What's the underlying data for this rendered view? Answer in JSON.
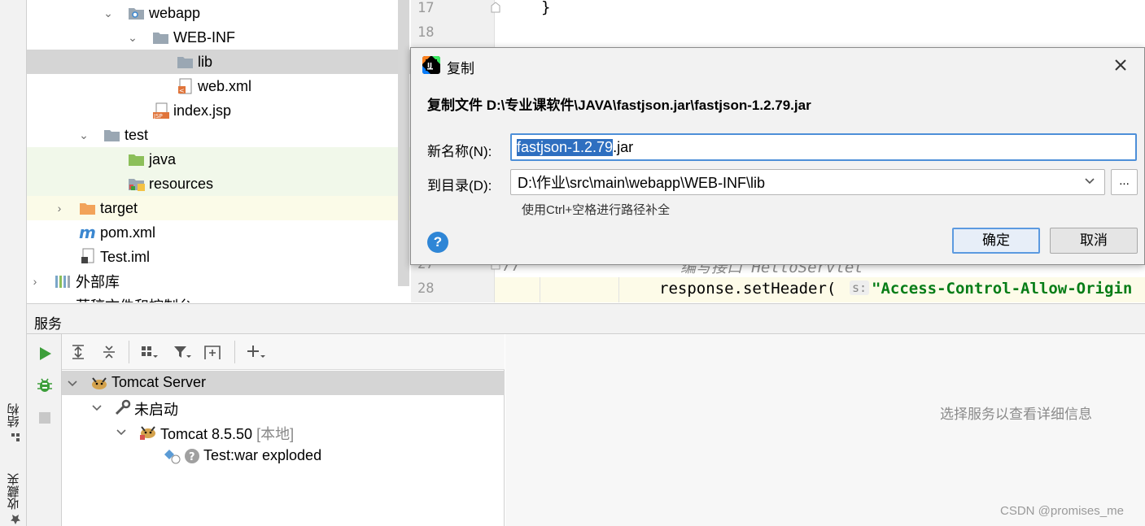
{
  "left_strip": {
    "structure_tab": "结构",
    "favorites_tab": "收藏夹"
  },
  "project_tree": {
    "items": [
      {
        "label": "webapp"
      },
      {
        "label": "WEB-INF"
      },
      {
        "label": "lib"
      },
      {
        "label": "web.xml"
      },
      {
        "label": "index.jsp"
      },
      {
        "label": "test"
      },
      {
        "label": "java"
      },
      {
        "label": "resources"
      },
      {
        "label": "target"
      },
      {
        "label": "pom.xml"
      },
      {
        "label": "Test.iml"
      },
      {
        "label": "外部库"
      },
      {
        "label": "草稿文件和控制台"
      }
    ]
  },
  "editor": {
    "line_numbers": [
      "17",
      "18",
      "27",
      "28"
    ],
    "line17_code": "}",
    "line27_code": "//",
    "line27_comment": "编写接口 HelloServlet",
    "line28_code": "response.setHeader(",
    "line28_hint": "s:",
    "line28_string": "\"Access-Control-Allow-Origin"
  },
  "dialog": {
    "title": "复制",
    "heading": "复制文件 D:\\专业课软件\\JAVA\\fastjson.jar\\fastjson-1.2.79.jar",
    "name_label": "新名称(N):",
    "name_value_selected": "fastjson-1.2.79",
    "name_value_rest": ".jar",
    "dir_label": "到目录(D):",
    "dir_value": "D:\\作业\\src\\main\\webapp\\WEB-INF\\lib",
    "browse_label": "...",
    "hint": "使用Ctrl+空格进行路径补全",
    "help_label": "?",
    "ok_label": "确定",
    "cancel_label": "取消"
  },
  "services": {
    "title": "服务",
    "tree": [
      {
        "label": "Tomcat Server"
      },
      {
        "label": "未启动"
      },
      {
        "label": "Tomcat 8.5.50",
        "suffix": "[本地]"
      },
      {
        "label": "Test:war exploded"
      }
    ],
    "detail_placeholder": "选择服务以查看详细信息"
  },
  "watermark": "CSDN @promises_me",
  "colors": {
    "accent": "#4d8fd8",
    "selection": "#2e6fc0",
    "run_green": "#3c9e3a",
    "folder_gray": "#9aa7b3",
    "folder_orange": "#f2a35a",
    "string_green": "#067d17"
  }
}
